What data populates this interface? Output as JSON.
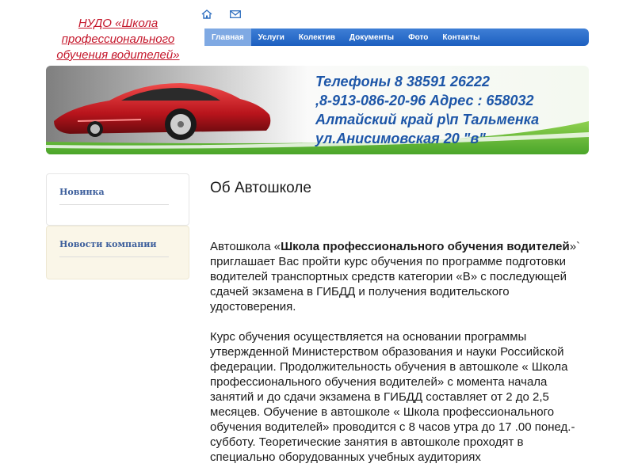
{
  "logo": {
    "line1": "НУДО «Школа",
    "line2": "профессионального",
    "line3": "обучения водителей»"
  },
  "top_icons": [
    {
      "name": "home-icon"
    },
    {
      "name": "mail-icon"
    }
  ],
  "menu": {
    "items": [
      {
        "label": "Главная",
        "active": true
      },
      {
        "label": "Услуги"
      },
      {
        "label": "Колектив"
      },
      {
        "label": "Документы"
      },
      {
        "label": "Фото"
      },
      {
        "label": "Контакты"
      }
    ]
  },
  "banner": {
    "line1": "Телефоны 8 38591 26222",
    "line2": ",8-913-086-20-96 Адрес : 658032",
    "line3": "Алтайский край р\\п Тальменка",
    "line4": "ул.Анисимовская 20 \"в\""
  },
  "sidebar": {
    "items": [
      {
        "label": "Новинка"
      },
      {
        "label": "Новости компании"
      }
    ]
  },
  "main": {
    "title": "Об Автошколе",
    "p1_prefix": "Автошкола «",
    "p1_bold": "Школа профессионального обучения водителей",
    "p1_rest": "»` приглашает Вас пройти курс обучения по программе подготовки водителей транспортных средств категории «В» с последующей сдачей экзамена в ГИБДД и получения водительского удостоверения.",
    "p2": "Курс обучения осуществляется на основании программы утвержденной Министерством образования и науки Российской федерации. Продолжительность обучения в автошколе « Школа профессионального обучения водителей» с момента начала занятий и до сдачи экзамена в ГИБДД составляет от 2 до 2,5 месяцев. Обучение в автошколе « Школа профессионального обучения водителей» проводится с 8 часов утра до 17 .00 понед.- субботу. Теоретические занятия в автошколе проходят в специально оборудованных учебных аудиториях"
  },
  "colors": {
    "brand_red": "#c4162a",
    "menu_blue": "#1c5fc0",
    "menu_active": "#7fa9e3",
    "banner_text": "#1d56a8",
    "sidebar_link": "#3d5f9c"
  }
}
